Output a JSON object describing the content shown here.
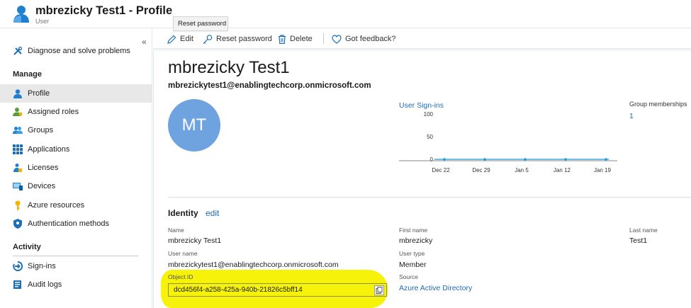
{
  "header": {
    "title": "mbrezicky Test1 - Profile",
    "subtitle": "User"
  },
  "tooltip": {
    "text": "Reset password"
  },
  "sidebar": {
    "collapse_glyph": "«",
    "diagnose": {
      "label": "Diagnose and solve problems",
      "icon": "wrench-cross-icon"
    },
    "manage_heading": "Manage",
    "items": [
      {
        "label": "Profile",
        "icon": "person-icon",
        "active": true
      },
      {
        "label": "Assigned roles",
        "icon": "person-roles-icon"
      },
      {
        "label": "Groups",
        "icon": "group-icon"
      },
      {
        "label": "Applications",
        "icon": "grid-icon"
      },
      {
        "label": "Licenses",
        "icon": "license-icon"
      },
      {
        "label": "Devices",
        "icon": "device-icon"
      },
      {
        "label": "Azure resources",
        "icon": "key-icon"
      },
      {
        "label": "Authentication methods",
        "icon": "shield-icon"
      }
    ],
    "activity_heading": "Activity",
    "activity_items": [
      {
        "label": "Sign-ins",
        "icon": "signin-arrow-icon"
      },
      {
        "label": "Audit logs",
        "icon": "audit-log-icon"
      }
    ]
  },
  "toolbar": {
    "edit": "Edit",
    "reset_password": "Reset password",
    "delete": "Delete",
    "feedback": "Got feedback?"
  },
  "profile": {
    "display_name": "mbrezicky Test1",
    "upn": "mbrezickytest1@enablingtechcorp.onmicrosoft.com",
    "initials": "MT",
    "group_memberships_label": "Group memberships",
    "group_memberships_value": "1"
  },
  "chart_data": {
    "type": "line",
    "title": "User Sign-ins",
    "categories": [
      "Dec 22",
      "Dec 29",
      "Jan 5",
      "Jan 12",
      "Jan 19"
    ],
    "series": [
      {
        "values": [
          0,
          0,
          0,
          0,
          0
        ]
      }
    ],
    "ylim": [
      0,
      100
    ],
    "yticks": [
      "100",
      "50",
      "0"
    ],
    "accent": "#1d9bd6"
  },
  "identity": {
    "heading": "Identity",
    "edit": "edit",
    "name_label": "Name",
    "name_value": "mbrezicky Test1",
    "username_label": "User name",
    "username_value": "mbrezickytest1@enablingtechcorp.onmicrosoft.com",
    "objectid_label": "Object ID",
    "objectid_value": "dcd456f4-a258-425a-940b-21826c5bff14",
    "firstname_label": "First name",
    "firstname_value": "mbrezicky",
    "usertype_label": "User type",
    "usertype_value": "Member",
    "source_label": "Source",
    "source_value": "Azure Active Directory",
    "lastname_label": "Last name",
    "lastname_value": "Test1"
  },
  "colors": {
    "link": "#1d6cb8",
    "highlight": "#f6f20a",
    "avatar": "#6fa3e0"
  }
}
